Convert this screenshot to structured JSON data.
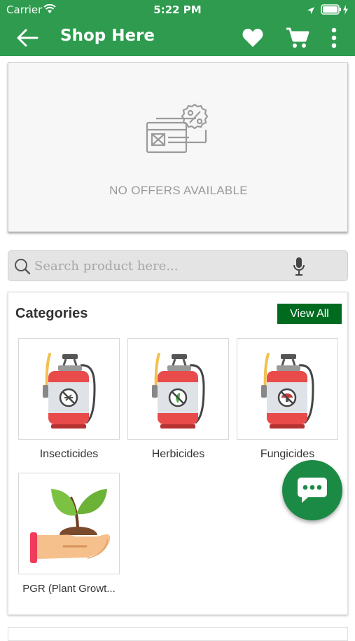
{
  "status_bar": {
    "carrier": "Carrier",
    "time": "5:22 PM"
  },
  "header": {
    "title": "Shop Here",
    "icons": [
      "back-arrow-icon",
      "heart-icon",
      "cart-icon",
      "more-vert-icon"
    ]
  },
  "offers": {
    "empty_text": "NO OFFERS AVAILABLE"
  },
  "search": {
    "placeholder": "Search product here..."
  },
  "categories": {
    "title": "Categories",
    "view_all_label": "View All",
    "items": [
      {
        "label": "Insecticides",
        "icon": "insecticide-sprayer-icon"
      },
      {
        "label": "Herbicides",
        "icon": "herbicide-sprayer-icon"
      },
      {
        "label": "Fungicides",
        "icon": "fungicide-sprayer-icon"
      },
      {
        "label": "PGR (Plant Growt...",
        "icon": "plant-in-hand-icon"
      }
    ]
  },
  "colors": {
    "primary": "#2e9b4e",
    "view_all_bg": "#006b1f",
    "fab": "#1b8a45"
  }
}
